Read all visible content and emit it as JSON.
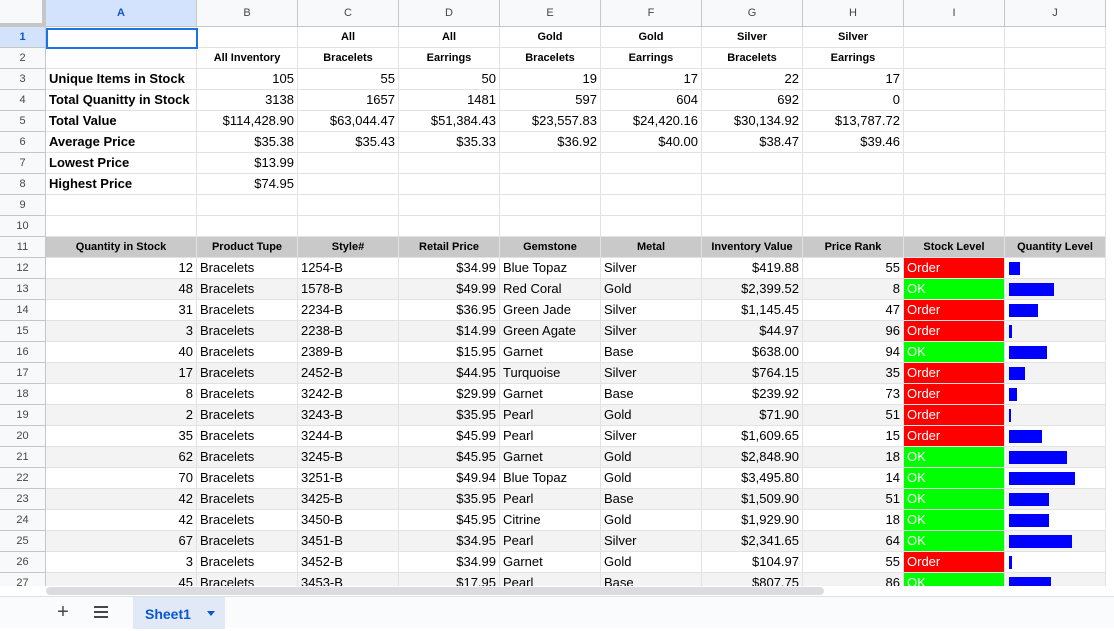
{
  "columns": [
    "A",
    "B",
    "C",
    "D",
    "E",
    "F",
    "G",
    "H",
    "I",
    "J"
  ],
  "selected_column": "A",
  "selected_row": 1,
  "rows": [
    1,
    2,
    3,
    4,
    5,
    6,
    7,
    8,
    9,
    10,
    11,
    12,
    13,
    14,
    15,
    16,
    17,
    18,
    19,
    20,
    21,
    22,
    23,
    24,
    25,
    26,
    27
  ],
  "summary": {
    "headers_row1": [
      "",
      "",
      "All",
      "All",
      "Gold",
      "Gold",
      "Silver",
      "Silver"
    ],
    "headers_row2": [
      "",
      "All Inventory",
      "Bracelets",
      "Earrings",
      "Bracelets",
      "Earrings",
      "Bracelets",
      "Earrings"
    ],
    "rows": [
      {
        "label": "Unique Items in Stock",
        "values": [
          "105",
          "55",
          "50",
          "19",
          "17",
          "22",
          "17"
        ]
      },
      {
        "label": "Total Quanitty in Stock",
        "values": [
          "3138",
          "1657",
          "1481",
          "597",
          "604",
          "692",
          "0"
        ]
      },
      {
        "label": "Total Value",
        "values": [
          "$114,428.90",
          "$63,044.47",
          "$51,384.43",
          "$23,557.83",
          "$24,420.16",
          "$30,134.92",
          "$13,787.72"
        ]
      },
      {
        "label": "Average Price",
        "values": [
          "$35.38",
          "$35.43",
          "$35.33",
          "$36.92",
          "$40.00",
          "$38.47",
          "$39.46"
        ]
      },
      {
        "label": "Lowest Price",
        "values": [
          "$13.99",
          "",
          "",
          "",
          "",
          "",
          ""
        ]
      },
      {
        "label": "Highest Price",
        "values": [
          "$74.95",
          "",
          "",
          "",
          "",
          "",
          ""
        ]
      }
    ]
  },
  "table": {
    "headers": [
      "Quantity in Stock",
      "Product Tupe",
      "Style#",
      "Retail Price",
      "Gemstone",
      "Metal",
      "Inventory Value",
      "Price Rank",
      "Stock Level",
      "Quantity Level"
    ],
    "rows": [
      {
        "qty": "12",
        "type": "Bracelets",
        "style": "1254-B",
        "price": "$34.99",
        "gem": "Blue Topaz",
        "metal": "Silver",
        "value": "$419.88",
        "rank": "55",
        "stock": "Order"
      },
      {
        "qty": "48",
        "type": "Bracelets",
        "style": "1578-B",
        "price": "$49.99",
        "gem": "Red Coral",
        "metal": "Gold",
        "value": "$2,399.52",
        "rank": "8",
        "stock": "OK"
      },
      {
        "qty": "31",
        "type": "Bracelets",
        "style": "2234-B",
        "price": "$36.95",
        "gem": "Green Jade",
        "metal": "Silver",
        "value": "$1,145.45",
        "rank": "47",
        "stock": "Order"
      },
      {
        "qty": "3",
        "type": "Bracelets",
        "style": "2238-B",
        "price": "$14.99",
        "gem": "Green Agate",
        "metal": "Silver",
        "value": "$44.97",
        "rank": "96",
        "stock": "Order"
      },
      {
        "qty": "40",
        "type": "Bracelets",
        "style": "2389-B",
        "price": "$15.95",
        "gem": "Garnet",
        "metal": "Base",
        "value": "$638.00",
        "rank": "94",
        "stock": "OK"
      },
      {
        "qty": "17",
        "type": "Bracelets",
        "style": "2452-B",
        "price": "$44.95",
        "gem": "Turquoise",
        "metal": "Silver",
        "value": "$764.15",
        "rank": "35",
        "stock": "Order"
      },
      {
        "qty": "8",
        "type": "Bracelets",
        "style": "3242-B",
        "price": "$29.99",
        "gem": "Garnet",
        "metal": "Base",
        "value": "$239.92",
        "rank": "73",
        "stock": "Order"
      },
      {
        "qty": "2",
        "type": "Bracelets",
        "style": "3243-B",
        "price": "$35.95",
        "gem": "Pearl",
        "metal": "Gold",
        "value": "$71.90",
        "rank": "51",
        "stock": "Order"
      },
      {
        "qty": "35",
        "type": "Bracelets",
        "style": "3244-B",
        "price": "$45.99",
        "gem": "Pearl",
        "metal": "Silver",
        "value": "$1,609.65",
        "rank": "15",
        "stock": "Order"
      },
      {
        "qty": "62",
        "type": "Bracelets",
        "style": "3245-B",
        "price": "$45.95",
        "gem": "Garnet",
        "metal": "Gold",
        "value": "$2,848.90",
        "rank": "18",
        "stock": "OK"
      },
      {
        "qty": "70",
        "type": "Bracelets",
        "style": "3251-B",
        "price": "$49.94",
        "gem": "Blue Topaz",
        "metal": "Gold",
        "value": "$3,495.80",
        "rank": "14",
        "stock": "OK"
      },
      {
        "qty": "42",
        "type": "Bracelets",
        "style": "3425-B",
        "price": "$35.95",
        "gem": "Pearl",
        "metal": "Base",
        "value": "$1,509.90",
        "rank": "51",
        "stock": "OK"
      },
      {
        "qty": "42",
        "type": "Bracelets",
        "style": "3450-B",
        "price": "$45.95",
        "gem": "Citrine",
        "metal": "Gold",
        "value": "$1,929.90",
        "rank": "18",
        "stock": "OK"
      },
      {
        "qty": "67",
        "type": "Bracelets",
        "style": "3451-B",
        "price": "$34.95",
        "gem": "Pearl",
        "metal": "Silver",
        "value": "$2,341.65",
        "rank": "64",
        "stock": "OK"
      },
      {
        "qty": "3",
        "type": "Bracelets",
        "style": "3452-B",
        "price": "$34.99",
        "gem": "Garnet",
        "metal": "Gold",
        "value": "$104.97",
        "rank": "55",
        "stock": "Order"
      },
      {
        "qty": "45",
        "type": "Bracelets",
        "style": "3453-B",
        "price": "$17.95",
        "gem": "Pearl",
        "metal": "Base",
        "value": "$807.75",
        "rank": "86",
        "stock": "OK"
      }
    ]
  },
  "quantity_bar_max": 70,
  "colors": {
    "order": "#ff0000",
    "ok": "#00ff00",
    "bar": "#0000ff",
    "header_gray": "#c9c9c9",
    "selection": "#1a73e8"
  },
  "tabs": {
    "add_label": "+",
    "sheet_name": "Sheet1"
  },
  "icons": {
    "add": "plus-icon",
    "all_sheets": "hamburger-menu-icon",
    "tab_menu": "caret-down-icon"
  }
}
